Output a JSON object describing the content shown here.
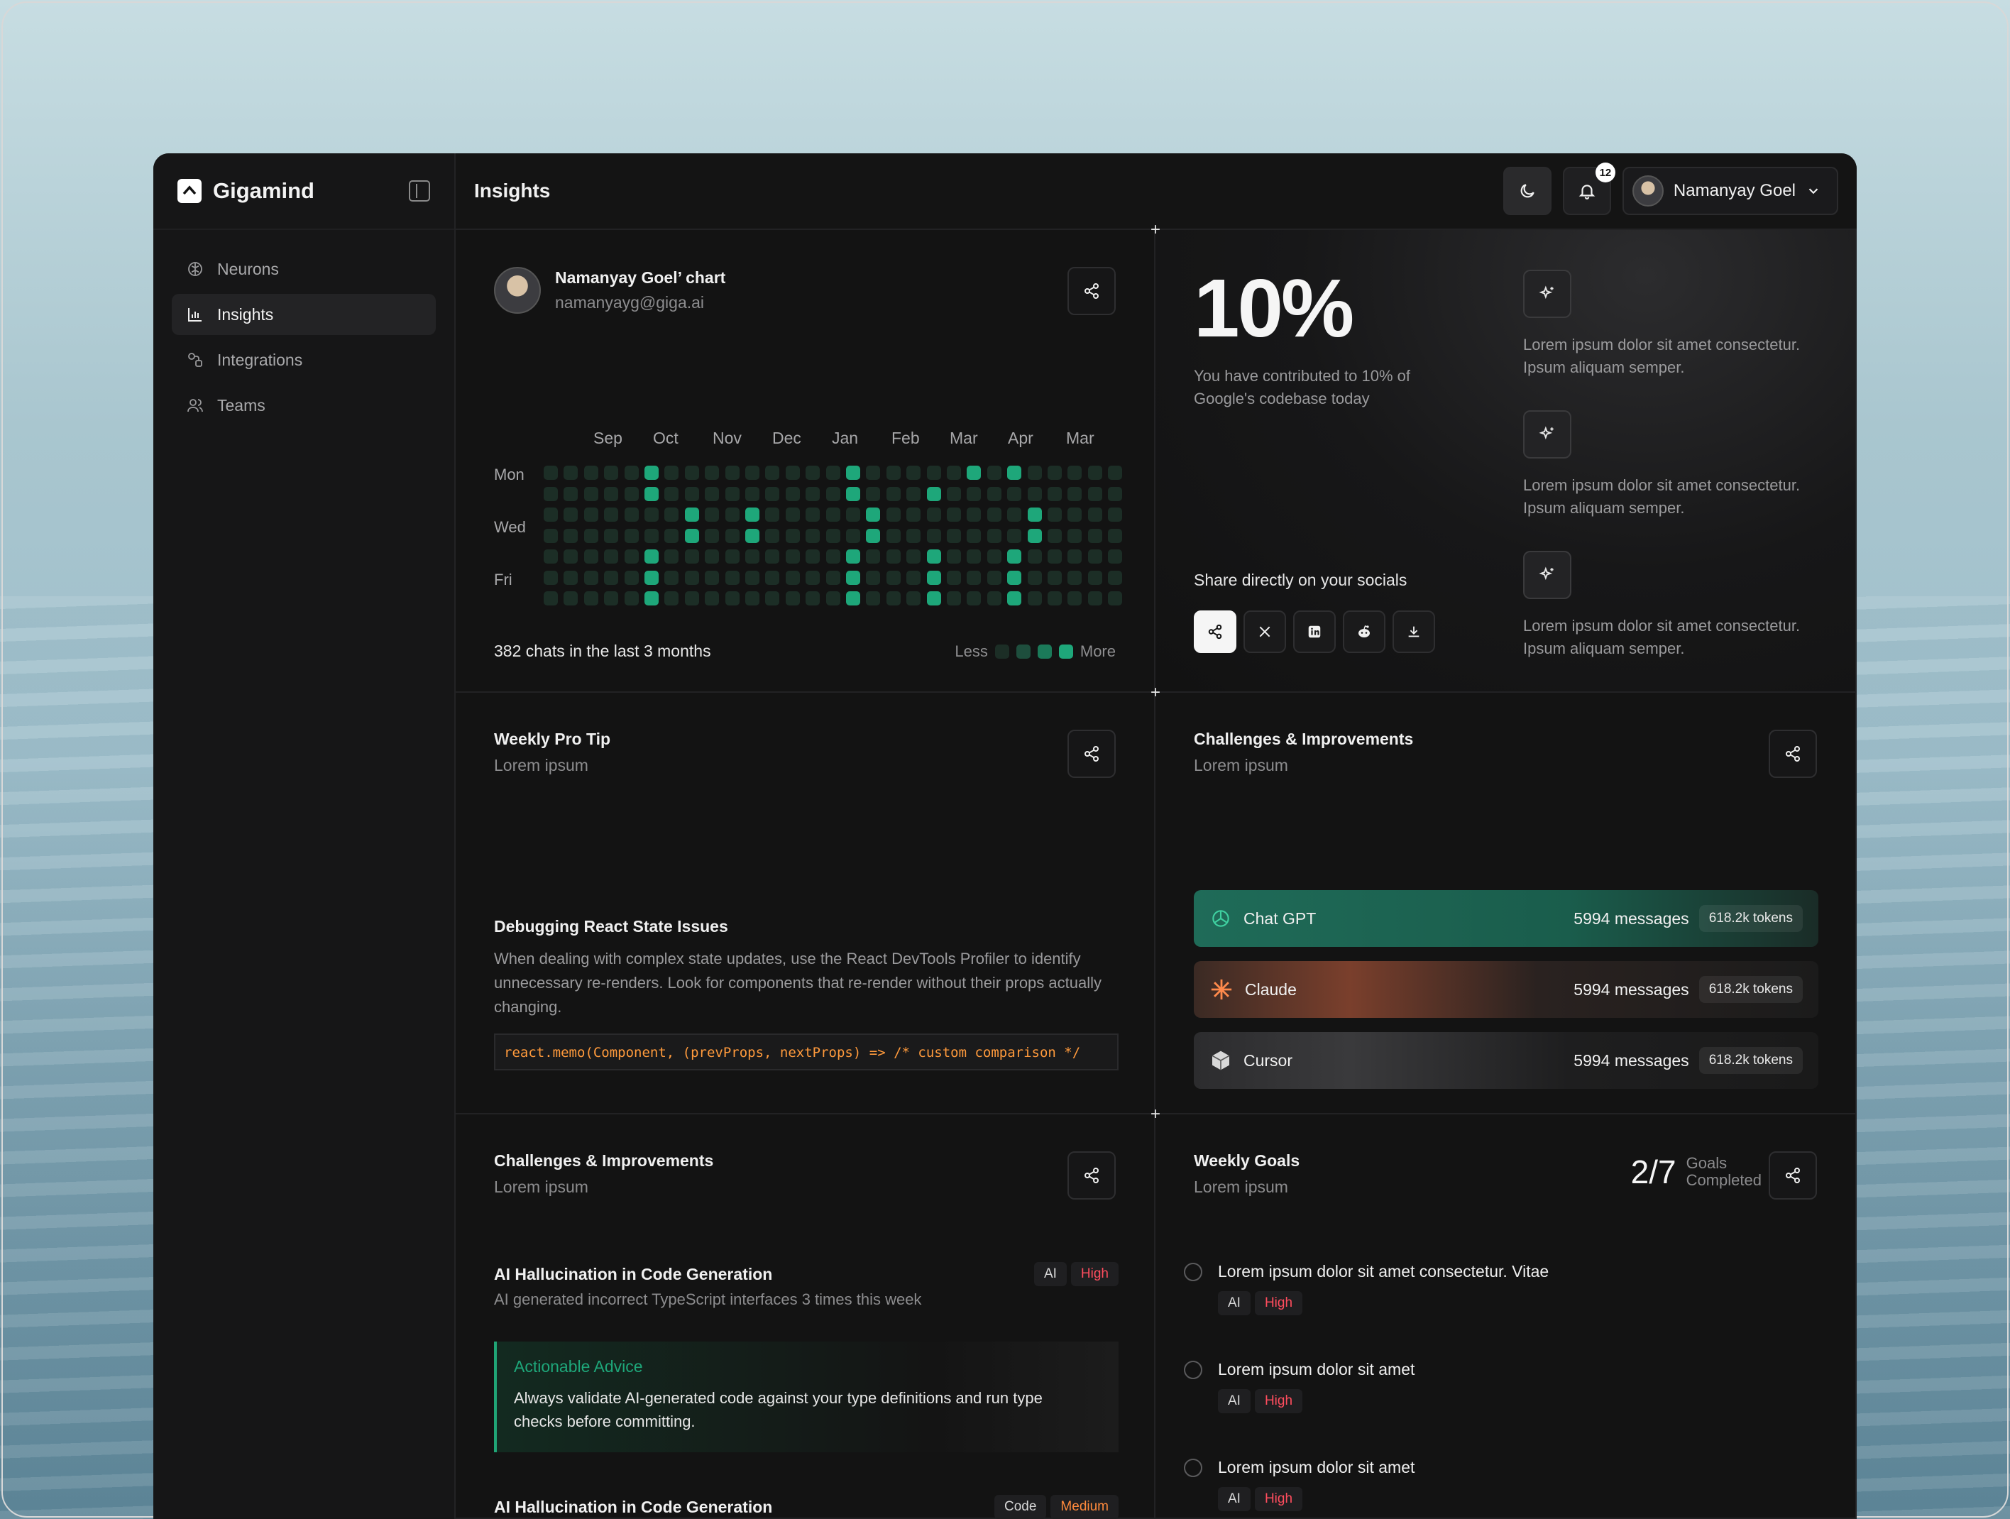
{
  "app": {
    "name": "Gigamind"
  },
  "sidebar": {
    "items": [
      {
        "label": "Neurons",
        "icon": "brain-icon",
        "active": false
      },
      {
        "label": "Insights",
        "icon": "chart-bar-icon",
        "active": true
      },
      {
        "label": "Integrations",
        "icon": "integrations-icon",
        "active": false
      },
      {
        "label": "Teams",
        "icon": "users-icon",
        "active": false
      }
    ]
  },
  "header": {
    "title": "Insights",
    "notification_count": "12",
    "user_name": "Namanyay Goel"
  },
  "activity": {
    "title": "Namanyay Goel’ chart",
    "email": "namanyayg@giga.ai",
    "months": [
      "Sep",
      "Oct",
      "Nov",
      "Dec",
      "Jan",
      "Feb",
      "Mar",
      "Apr",
      "Mar"
    ],
    "days": [
      "Mon",
      "Wed",
      "Fri"
    ],
    "summary": "382 chats in the last 3 months",
    "legend_less": "Less",
    "legend_more": "More",
    "accent": "#1ea77a"
  },
  "contribution": {
    "percent": "10%",
    "text": "You have contributed to 10% of Google's codebase today",
    "share_label": "Share directly on your socials",
    "socials": [
      "share-icon",
      "x-icon",
      "linkedin-icon",
      "reddit-icon",
      "download-icon"
    ],
    "tips": [
      "Lorem ipsum dolor sit amet consectetur. Ipsum aliquam semper.",
      "Lorem ipsum dolor sit amet consectetur. Ipsum aliquam semper.",
      "Lorem ipsum dolor sit amet consectetur. Ipsum aliquam semper."
    ]
  },
  "weekly_tip": {
    "title": "Weekly Pro Tip",
    "subtitle": "Lorem ipsum",
    "tip_title": "Debugging React State Issues",
    "tip_body": "When dealing with complex state updates, use the React DevTools Profiler to identify unnecessary re-renders. Look for components that re-render without their props actually changing.",
    "code": "react.memo(Component, (prevProps, nextProps) => /* custom comparison */"
  },
  "challenges_models": {
    "title": "Challenges & Improvements",
    "subtitle": "Lorem ipsum",
    "models": [
      {
        "name": "Chat GPT",
        "messages": "5994 messages",
        "tokens": "618.2k tokens",
        "color": "#1f6b58"
      },
      {
        "name": "Claude",
        "messages": "5994 messages",
        "tokens": "618.2k tokens",
        "color": "#7a3f2c"
      },
      {
        "name": "Cursor",
        "messages": "5994 messages",
        "tokens": "618.2k tokens",
        "color": "#3a3a3c"
      }
    ]
  },
  "challenges_list": {
    "title": "Challenges & Improvements",
    "subtitle": "Lorem ipsum",
    "items": [
      {
        "title": "AI Hallucination in Code Generation",
        "desc": "AI generated incorrect TypeScript interfaces 3 times this week",
        "tag1": "AI",
        "tag2": "High"
      },
      {
        "title": "AI Hallucination in Code Generation",
        "tag1": "Code",
        "tag2": "Medium"
      }
    ],
    "advice_title": "Actionable Advice",
    "advice_text": "Always validate AI-generated code against your type definitions and run type checks before committing."
  },
  "weekly_goals": {
    "title": "Weekly Goals",
    "subtitle": "Lorem ipsum",
    "count": "2/7",
    "count_label_1": "Goals",
    "count_label_2": "Completed",
    "goals": [
      {
        "text": "Lorem ipsum dolor sit amet consectetur. Vitae",
        "tag1": "AI",
        "tag2": "High"
      },
      {
        "text": "Lorem ipsum dolor sit amet",
        "tag1": "AI",
        "tag2": "High"
      },
      {
        "text": "Lorem ipsum dolor sit amet",
        "tag1": "AI",
        "tag2": "High"
      }
    ]
  }
}
